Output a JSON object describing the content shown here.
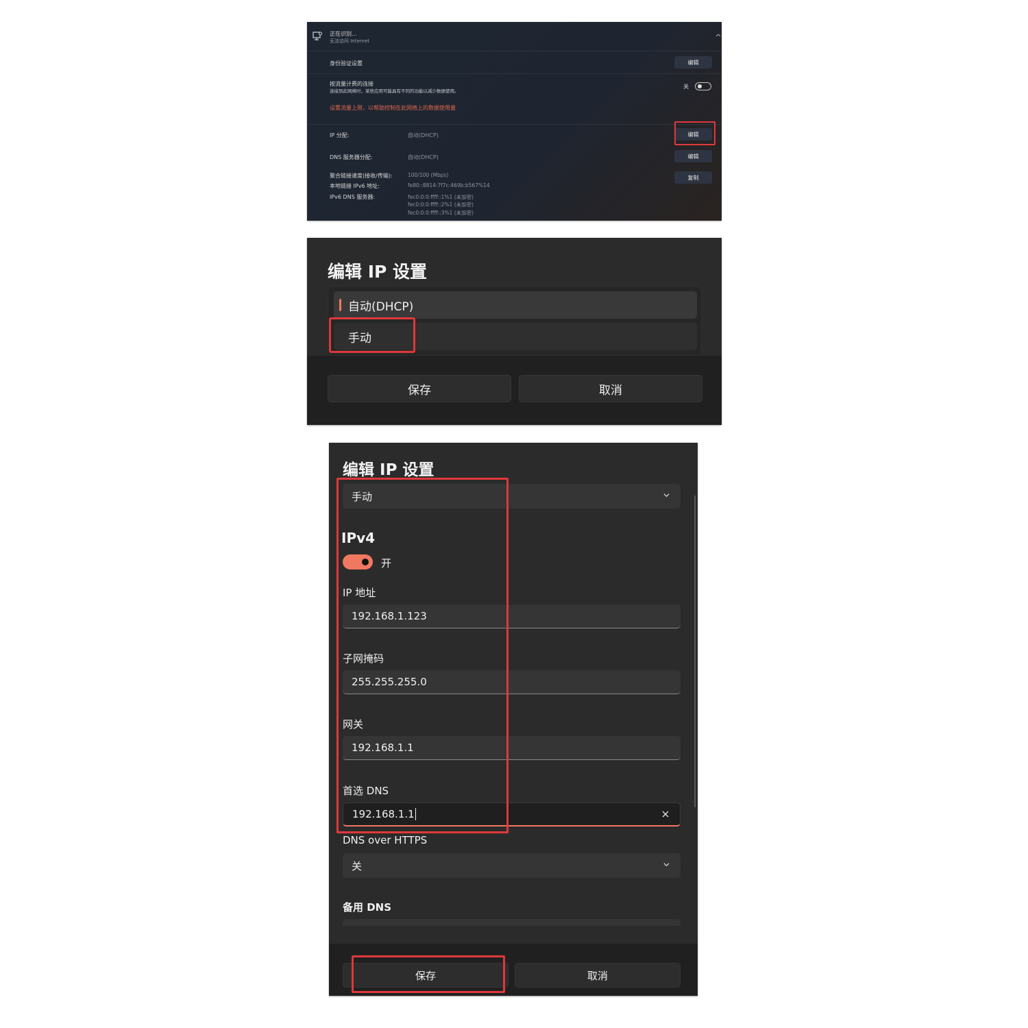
{
  "panel1": {
    "network_status": "正在识别...",
    "network_substatus": "无法访问 Internet",
    "auth_label": "身份验证设置",
    "auth_button": "编辑",
    "metered_title": "按流量计费的连接",
    "metered_desc": "连接到此网络时，某些应用可能具有不同的功能以减少数据使用。",
    "metered_state": "关",
    "data_limit_link": "设置流量上限，以帮助控制在此网络上的数据使用量",
    "ip_label": "IP 分配:",
    "ip_value": "自动(DHCP)",
    "ip_button": "编辑",
    "dns_label": "DNS 服务器分配:",
    "dns_value": "自动(DHCP)",
    "dns_button": "编辑",
    "link_speed_label": "聚合链接速度(接收/传输):",
    "link_speed_value": "100/100 (Mbps)",
    "ipv6_label": "本地链接 IPv6 地址:",
    "ipv6_value": "fe80::8814:7f7c:469b:b567%14",
    "ipv6_dns_label": "IPv6 DNS 服务器:",
    "ipv6_dns_values": [
      "fec0:0:0:ffff::1%1 (未加密)",
      "fec0:0:0:ffff::2%1 (未加密)",
      "fec0:0:0:ffff::3%1 (未加密)"
    ],
    "copy_button": "复制"
  },
  "panel2": {
    "title": "编辑 IP 设置",
    "options": [
      "自动(DHCP)",
      "手动"
    ],
    "save": "保存",
    "cancel": "取消"
  },
  "panel3": {
    "title": "编辑 IP 设置",
    "mode_value": "手动",
    "ipv4_heading": "IPv4",
    "ipv4_toggle_state": "开",
    "ip_label": "IP 地址",
    "ip_value": "192.168.1.123",
    "subnet_label": "子网掩码",
    "subnet_value": "255.255.255.0",
    "gateway_label": "网关",
    "gateway_value": "192.168.1.1",
    "pref_dns_label": "首选 DNS",
    "pref_dns_value": "192.168.1.1",
    "doh_label": "DNS over HTTPS",
    "doh_value": "关",
    "alt_dns_label": "备用 DNS",
    "save": "保存",
    "cancel": "取消"
  },
  "colors": {
    "accent": "#f07860",
    "highlight_box": "#e0383b",
    "link": "#e0694f"
  }
}
